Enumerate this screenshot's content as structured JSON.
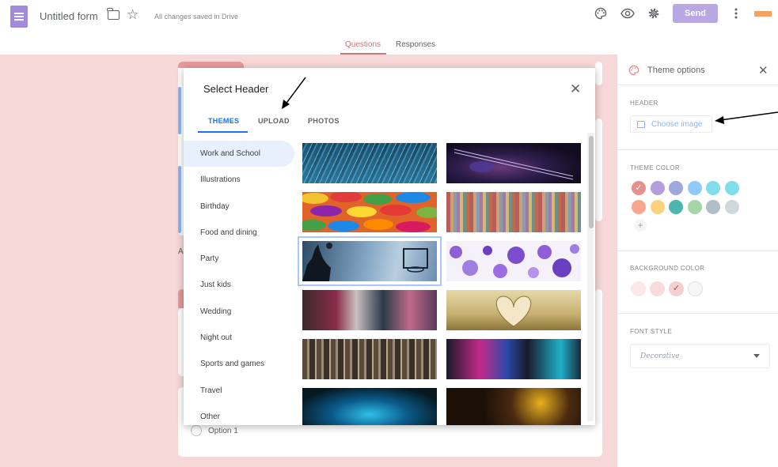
{
  "app": {
    "title": "Untitled form",
    "saved_status": "All changes saved in Drive",
    "send_label": "Send"
  },
  "tabs": {
    "questions": "Questions",
    "responses": "Responses"
  },
  "modal": {
    "title": "Select Header",
    "tabs": [
      "THEMES",
      "UPLOAD",
      "PHOTOS"
    ],
    "active_tab": "THEMES",
    "categories": [
      "Work and School",
      "Illustrations",
      "Birthday",
      "Food and dining",
      "Party",
      "Just kids",
      "Wedding",
      "Night out",
      "Sports and games",
      "Travel",
      "Other"
    ],
    "active_category": "Work and School",
    "thumbnails": [
      {
        "name": "circuit-board-thumb"
      },
      {
        "name": "guitar-thumb"
      },
      {
        "name": "candy-thumb"
      },
      {
        "name": "colored-pencils-thumb"
      },
      {
        "name": "basketball-thumb",
        "selected": true
      },
      {
        "name": "purple-bubbles-thumb"
      },
      {
        "name": "paint-tubes-thumb"
      },
      {
        "name": "book-heart-thumb"
      },
      {
        "name": "paintbrushes-thumb"
      },
      {
        "name": "lab-flasks-thumb"
      },
      {
        "name": "microscope-thumb"
      },
      {
        "name": "pencils-bokeh-thumb"
      }
    ]
  },
  "theme_panel": {
    "title": "Theme options",
    "header_label": "HEADER",
    "choose_image": "Choose image",
    "theme_color_label": "THEME COLOR",
    "theme_colors": [
      "#e6908e",
      "#b39ddb",
      "#9fa8da",
      "#90caf9",
      "#80deea",
      "#80deea",
      "#f8a78e",
      "#fdd17a",
      "#4db6ac",
      "#a5d6a7",
      "#b0bec5",
      "#cfd8dc"
    ],
    "selected_theme_color": "#e6908e",
    "background_color_label": "BACKGROUND COLOR",
    "background_colors": [
      "#fbe9e9",
      "#f8dcdc",
      "#f4cfcf",
      "#f6f6f6"
    ],
    "selected_background_color": "#f4cfcf",
    "font_style_label": "FONT STYLE",
    "font_style_value": "Decorative"
  },
  "form_preview": {
    "option_label": "Option 1",
    "peek_letter": "A"
  }
}
